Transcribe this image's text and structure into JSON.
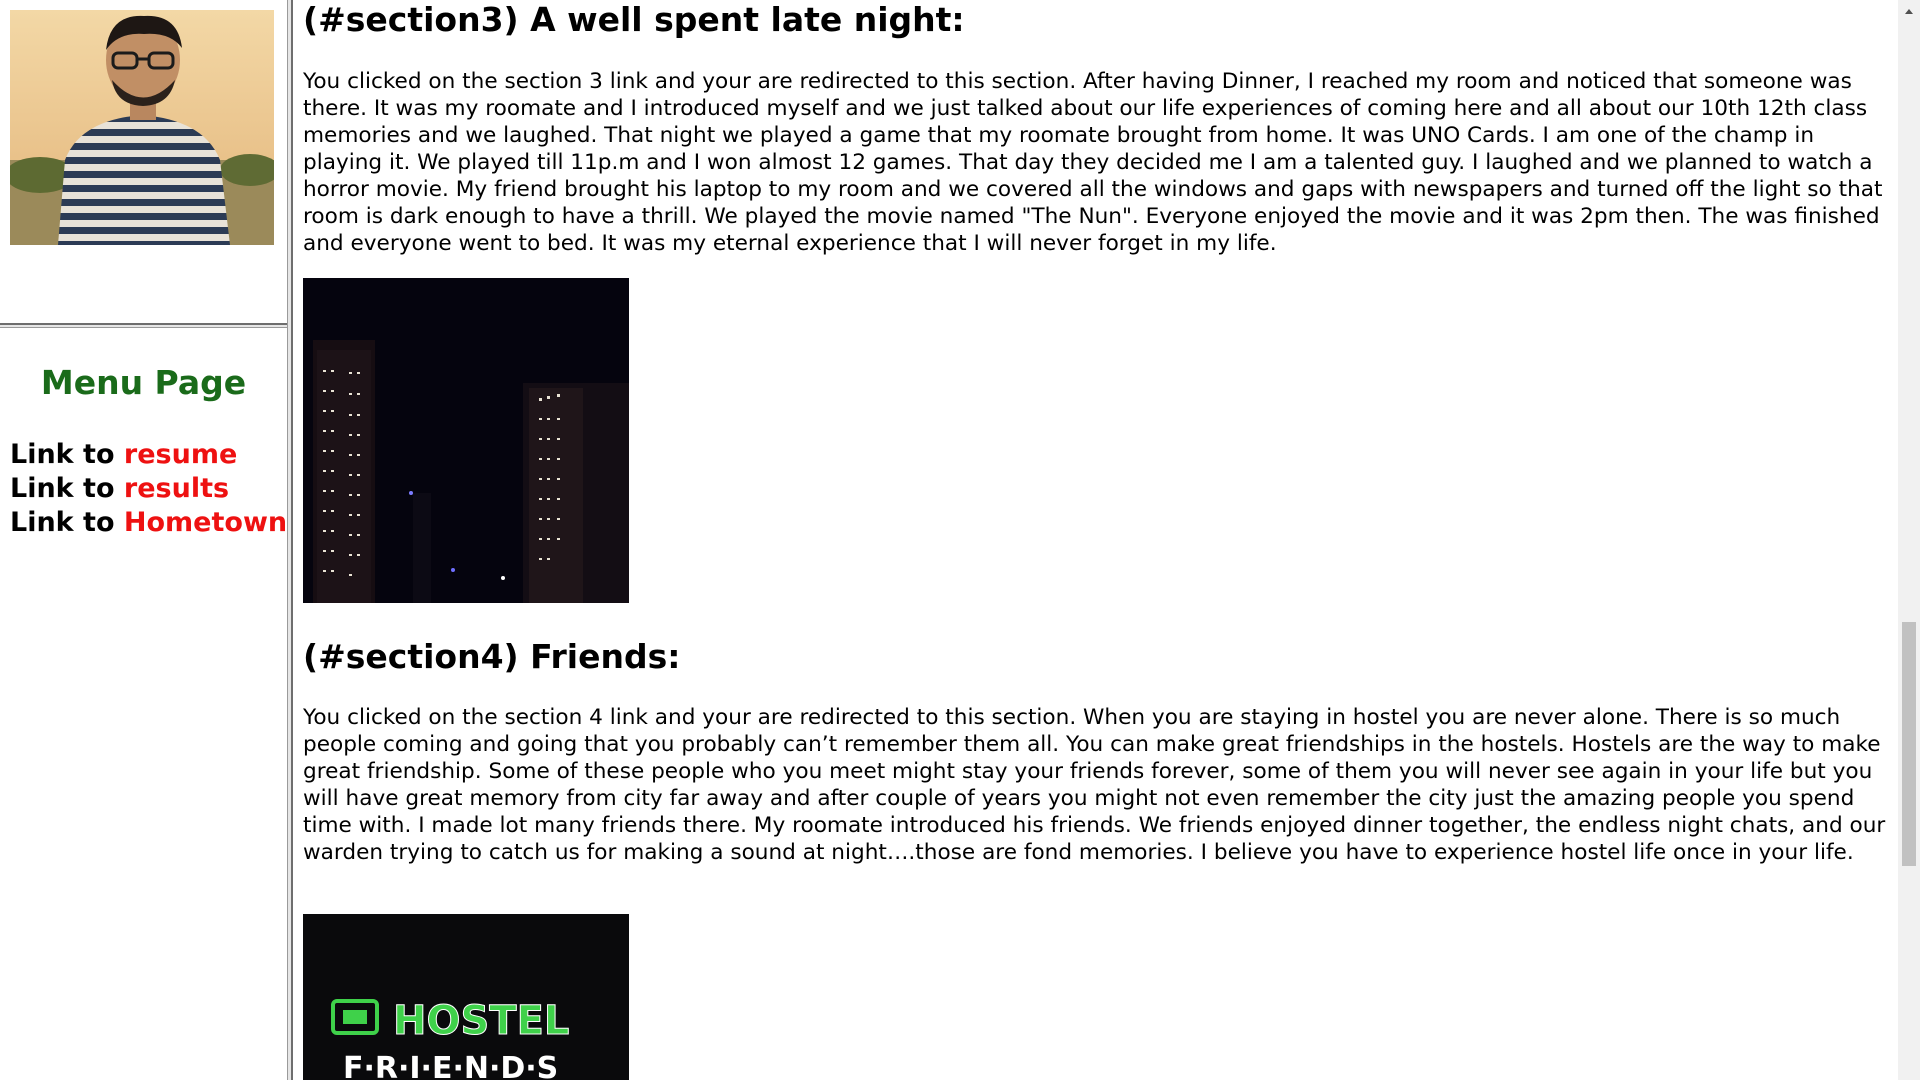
{
  "sidebar": {
    "menu_title": "Menu Page",
    "links": [
      {
        "prefix": "Link to",
        "label": "resume"
      },
      {
        "prefix": "Link to",
        "label": "results"
      },
      {
        "prefix": "Link to",
        "label": "Hometown"
      }
    ]
  },
  "content": {
    "section3": {
      "title": "(#section3) A well spent late night:",
      "text": "You clicked on the section 3 link and your are redirected to this section. After having Dinner, I reached my room and noticed that someone was there. It was my roomate and I introduced myself and we just talked about our life experiences of coming here and all about our 10th 12th class memories and we laughed. That night we played a game that my roomate brought from home. It was UNO Cards. I am one of the champ in playing it. We played till 11p.m and I won almost 12 games. That day they decided me I am a talented guy. I laughed and we planned to watch a horror movie. My friend brought his laptop to my room and we covered all the windows and gaps with newspapers and turned off the light so that room is dark enough to have a thrill. We played the movie named \"The Nun\". Everyone enjoyed the movie and it was 2pm then. The was finished and everyone went to bed. It was my eternal experience that I will never forget in my life."
    },
    "section4": {
      "title": "(#section4) Friends:",
      "text": "You clicked on the section 4 link and your are redirected to this section. When you are staying in hostel you are never alone. There is so much people coming and going that you probably can’t remember them all. You can make great friendships in the hostels. Hostels are the way to make great friendship. Some of these people who you meet might stay your friends forever, some of them you will never see again in your life but you will have great memory from city far away and after couple of years you might not even remember the city just the amazing people you spend time with. I made lot many friends there. My roomate introduced his friends. We friends enjoyed dinner together, the endless night chats, and our warden trying to catch us for making a sound at night….those are fond memories. I believe you have to experience hostel life once in your life."
    },
    "hostel_sign": {
      "line1": "HOSTEL",
      "line2": "F·R·I·E·N·D·S"
    }
  },
  "colors": {
    "menu_title": "#1a6b1a",
    "link": "#ee1111",
    "sign_green": "#3fd14a"
  }
}
